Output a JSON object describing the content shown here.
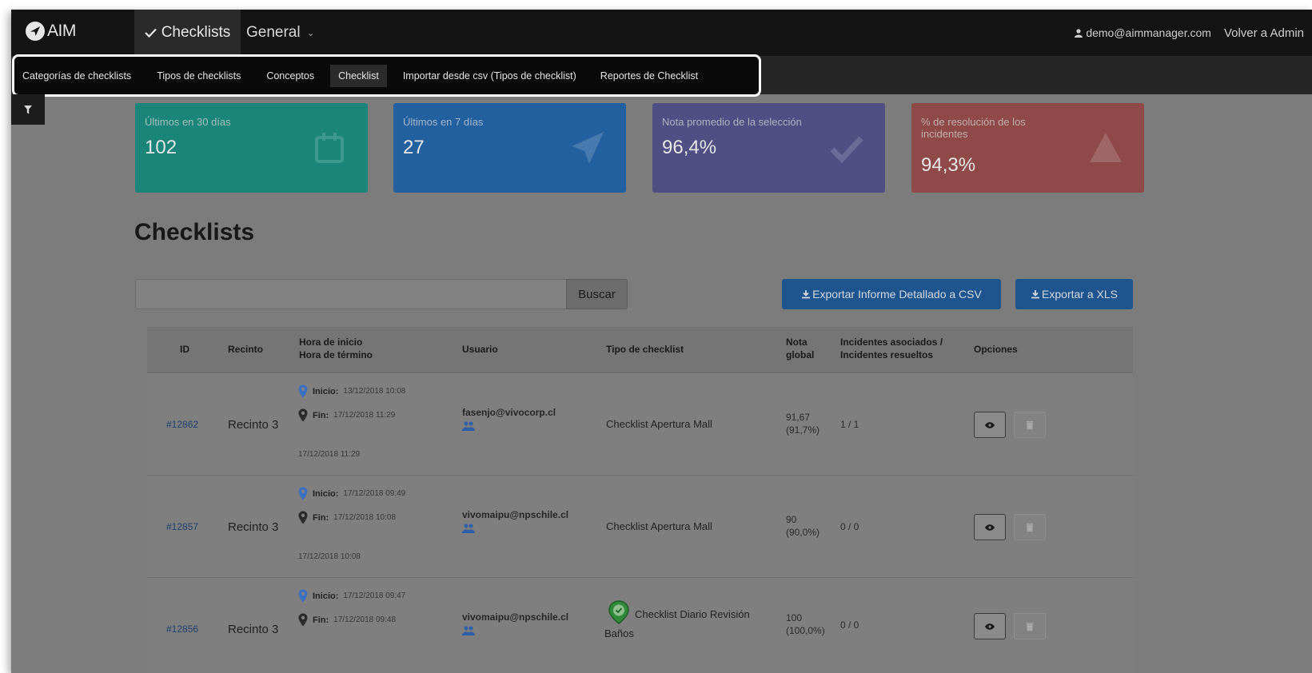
{
  "brand": {
    "name": "AIM"
  },
  "navbar": {
    "checklists_label": "Checklists",
    "general_label": "General",
    "user_email": "demo@aimmanager.com",
    "back_label": "Volver a Admin"
  },
  "subnav": {
    "items": [
      "Categorías de checklists",
      "Tipos de checklists",
      "Conceptos",
      "Checklist",
      "Importar desde csv (Tipos de checklist)",
      "Reportes de Checklist"
    ],
    "active_index": 3
  },
  "stats": [
    {
      "label": "Últimos en 30 días",
      "value": "102",
      "icon": "calendar-icon",
      "color": "#1b8579"
    },
    {
      "label": "Últimos en 7 días",
      "value": "27",
      "icon": "paper-plane-icon",
      "color": "#2360a0"
    },
    {
      "label": "Nota promedio de la selección",
      "value": "96,4%",
      "icon": "check-icon",
      "color": "#4f4f83"
    },
    {
      "label": "% de resolución de los incidentes",
      "value": "94,3%",
      "icon": "warning-icon",
      "color": "#8e4948"
    }
  ],
  "page_title": "Checklists",
  "search": {
    "value": "",
    "placeholder": "",
    "button_label": "Buscar"
  },
  "export": {
    "csv_label": "Exportar Informe Detallado a CSV",
    "xls_label": "Exportar a XLS"
  },
  "table": {
    "headers": {
      "id": "ID",
      "recinto": "Recinto",
      "hora_inicio": "Hora de inicio",
      "hora_termino": "Hora de término",
      "usuario": "Usuario",
      "tipo": "Tipo de checklist",
      "nota_1": "Nota",
      "nota_2": "global",
      "incid_1": "Incidentes asociados /",
      "incid_2": "Incidentes resueltos",
      "opciones": "Opciones"
    },
    "labels": {
      "inicio": "Inicio:",
      "fin": "Fin:"
    },
    "rows": [
      {
        "id": "#12862",
        "recinto": "Recinto 3",
        "inicio": "13/12/2018 10:08",
        "fin": "17/12/2018 11:29",
        "termino": "17/12/2018 11:29",
        "usuario": "fasenjo@vivocorp.cl",
        "tipo": "Checklist Apertura Mall",
        "nota": "91,67",
        "nota_pct": "(91,7%)",
        "incidentes": "1 / 1"
      },
      {
        "id": "#12857",
        "recinto": "Recinto 3",
        "inicio": "17/12/2018 09:49",
        "fin": "17/12/2018 10:08",
        "termino": "17/12/2018 10:08",
        "usuario": "vivomaipu@npschile.cl",
        "tipo": "Checklist Apertura Mall",
        "nota": "90",
        "nota_pct": "(90,0%)",
        "incidentes": "0 / 0"
      },
      {
        "id": "#12856",
        "recinto": "Recinto 3",
        "inicio": "17/12/2018 09:47",
        "fin": "17/12/2018 09:48",
        "termino": "",
        "usuario": "vivomaipu@npschile.cl",
        "tipo": "Checklist Diario Revisión",
        "tipo_2": "Baños",
        "nota": "100",
        "nota_pct": "(100,0%)",
        "incidentes": "0 / 0"
      }
    ]
  }
}
